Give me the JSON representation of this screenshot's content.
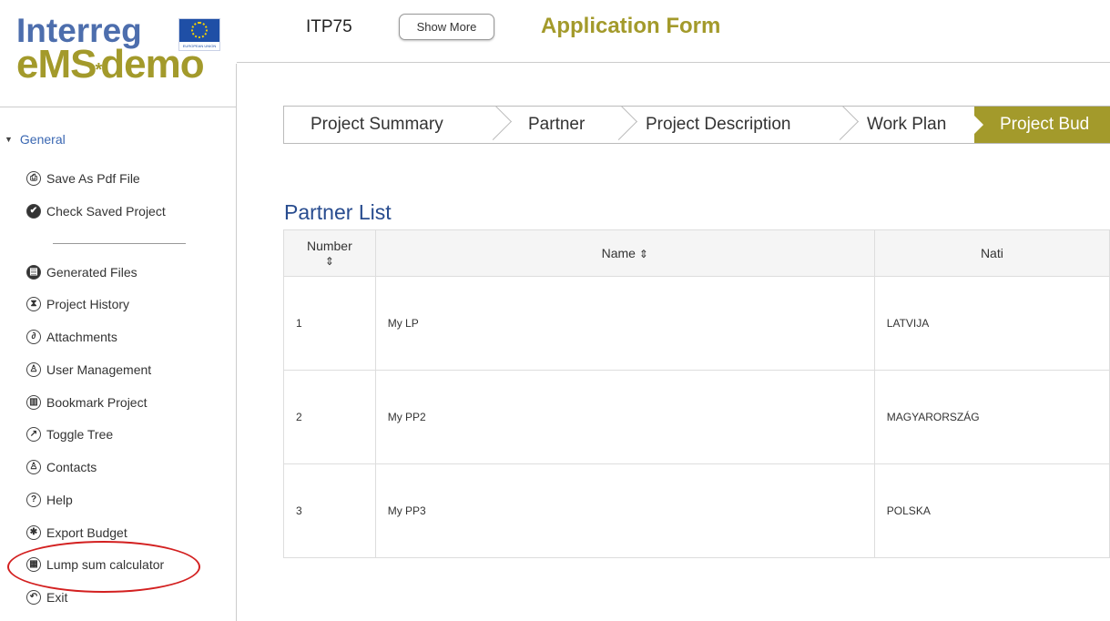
{
  "logo": {
    "line1": "Interreg",
    "line2_left": "eMS",
    "line2_star": "*",
    "line2_right": "demo",
    "flag_caption": "EUROPEAN UNION"
  },
  "header": {
    "project_code": "ITP75",
    "show_more_label": "Show More",
    "title": "Application Form"
  },
  "sidebar": {
    "section_label": "General",
    "items_top": [
      {
        "label": "Save As Pdf File",
        "icon": "print-icon",
        "glyph": "⎙"
      },
      {
        "label": "Check Saved Project",
        "icon": "check-icon",
        "glyph": "✔"
      }
    ],
    "items": [
      {
        "label": "Generated Files",
        "icon": "files-icon",
        "glyph": "▤"
      },
      {
        "label": "Project History",
        "icon": "history-icon",
        "glyph": "⧗"
      },
      {
        "label": "Attachments",
        "icon": "paperclip-icon",
        "glyph": "∂"
      },
      {
        "label": "User Management",
        "icon": "user-icon",
        "glyph": "♙"
      },
      {
        "label": "Bookmark Project",
        "icon": "bookmark-icon",
        "glyph": "▥"
      },
      {
        "label": "Toggle Tree",
        "icon": "external-link-icon",
        "glyph": "↗"
      },
      {
        "label": "Contacts",
        "icon": "contact-icon",
        "glyph": "♙"
      },
      {
        "label": "Help",
        "icon": "help-icon",
        "glyph": "?"
      },
      {
        "label": "Export Budget",
        "icon": "gear-icon",
        "glyph": "✱"
      },
      {
        "label": "Lump sum calculator",
        "icon": "calculator-icon",
        "glyph": "▦"
      },
      {
        "label": "Exit",
        "icon": "exit-icon",
        "glyph": "↶"
      }
    ]
  },
  "steps": [
    {
      "label": "Project Summary"
    },
    {
      "label": "Partner"
    },
    {
      "label": "Project Description"
    },
    {
      "label": "Work Plan"
    },
    {
      "label": "Project Bud"
    }
  ],
  "partner_list": {
    "title": "Partner List",
    "columns": [
      "Number",
      "Name",
      "Nati"
    ],
    "sort_glyph": "⇕",
    "rows": [
      {
        "number": "1",
        "name": "My LP",
        "nationality": "LATVIJA"
      },
      {
        "number": "2",
        "name": "My PP2",
        "nationality": "MAGYARORSZÁG"
      },
      {
        "number": "3",
        "name": "My PP3",
        "nationality": "POLSKA"
      }
    ]
  },
  "colors": {
    "brand_blue": "#4d6ead",
    "brand_olive": "#a39a2b",
    "link_blue": "#3a67b2",
    "title_blue": "#284c8f",
    "highlight_red": "#d32020"
  }
}
